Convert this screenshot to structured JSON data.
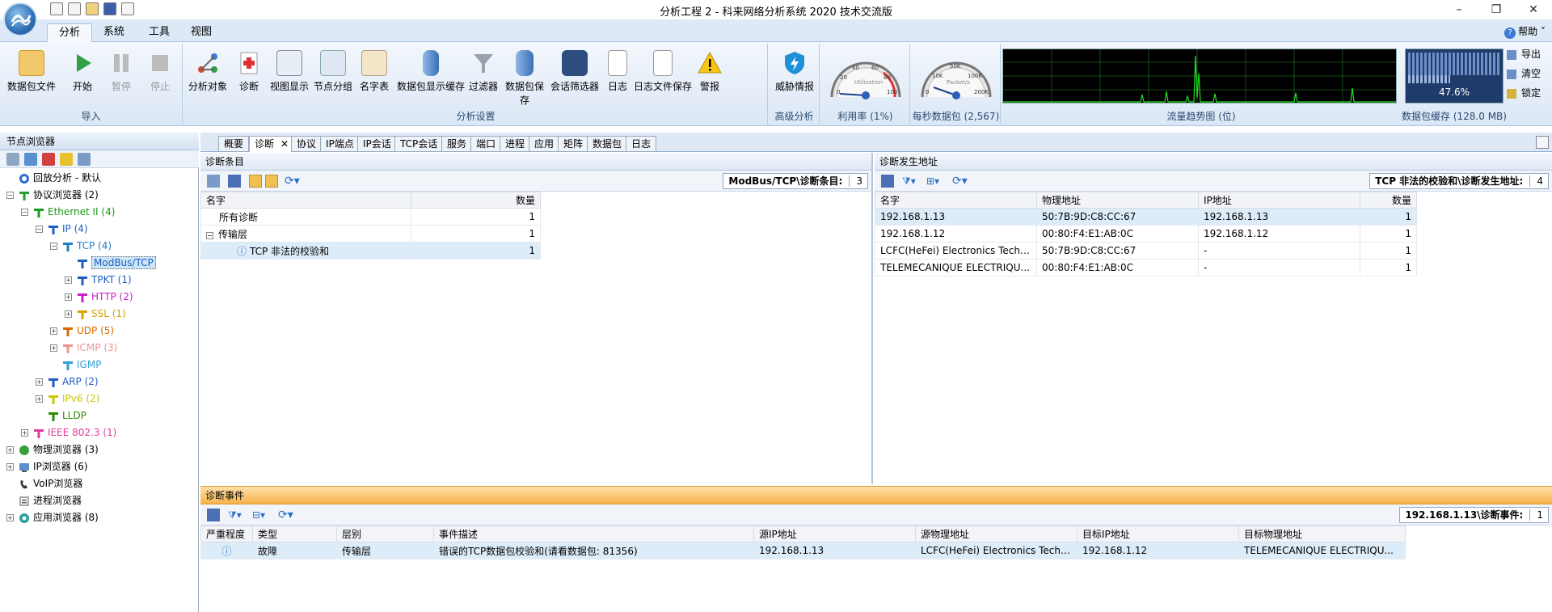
{
  "window": {
    "title": "分析工程 2 - 科来网络分析系统 2020 技术交流版",
    "min": "–",
    "max": "❐",
    "close": "✕"
  },
  "ribbon": {
    "tabs": [
      "分析",
      "系统",
      "工具",
      "视图"
    ],
    "help": "帮助",
    "groups": {
      "import": "导入",
      "analysis_settings": "分析设置",
      "advanced": "高级分析",
      "utilization": "利用率 (1%)",
      "pps": "每秒数据包 (2,567)",
      "trend": "流量趋势图 (位)",
      "buffer": "数据包缓存 (128.0 MB)"
    },
    "buttons": {
      "packet_file": "数据包文件",
      "start": "开始",
      "pause": "暂停",
      "stop": "停止",
      "analysis_object": "分析对象",
      "diagnosis": "诊断",
      "view_display": "视图显示",
      "node_group": "节点分组",
      "name_table": "名字表",
      "packet_display_buffer": "数据包显示缓存",
      "filter": "过滤器",
      "packet_save": "数据包保存",
      "session_filter": "会话筛选器",
      "log": "日志",
      "log_file_save": "日志文件保存",
      "alarm": "警报",
      "threat_intel": "威胁情报"
    },
    "gauge_util_label": "Utilization",
    "gauge_util_ticks": [
      "0",
      "20",
      "40",
      "60",
      "80",
      "100"
    ],
    "gauge_pps_label": "Packet/s",
    "gauge_pps_ticks": [
      "0",
      "10K",
      "50K",
      "100K",
      "200K"
    ],
    "buffer_pct": "47.6%",
    "side_buttons": [
      "导出",
      "清空",
      "锁定"
    ]
  },
  "node_browser": {
    "title": "节点浏览器",
    "tree": [
      {
        "label": "回放分析 - 默认",
        "color": "#000000"
      },
      {
        "label": "协议浏览器 (2)",
        "color": "#000000"
      },
      {
        "label": "Ethernet II (4)",
        "color": "#1a9a1a"
      },
      {
        "label": "IP (4)",
        "color": "#1f5fbf"
      },
      {
        "label": "TCP (4)",
        "color": "#1f7fbf"
      },
      {
        "label": "ModBus/TCP",
        "color": "#1f5fbf"
      },
      {
        "label": "TPKT (1)",
        "color": "#1f5fbf"
      },
      {
        "label": "HTTP (2)",
        "color": "#c81fc8"
      },
      {
        "label": "SSL (1)",
        "color": "#d8a000"
      },
      {
        "label": "UDP (5)",
        "color": "#d86a00"
      },
      {
        "label": "ICMP (3)",
        "color": "#f09090"
      },
      {
        "label": "IGMP",
        "color": "#2fa0d8"
      },
      {
        "label": "ARP (2)",
        "color": "#1f5fbf"
      },
      {
        "label": "IPv6 (2)",
        "color": "#c8c800"
      },
      {
        "label": "LLDP",
        "color": "#2a8a00"
      },
      {
        "label": "IEEE 802.3 (1)",
        "color": "#e03aa0"
      },
      {
        "label": "物理浏览器 (3)",
        "color": "#000000"
      },
      {
        "label": "IP浏览器 (6)",
        "color": "#000000"
      },
      {
        "label": "VoIP浏览器",
        "color": "#000000"
      },
      {
        "label": "进程浏览器",
        "color": "#000000"
      },
      {
        "label": "应用浏览器 (8)",
        "color": "#000000"
      }
    ]
  },
  "center_tabs": [
    "概要",
    "诊断",
    "协议",
    "IP端点",
    "IP会话",
    "TCP会话",
    "服务",
    "端口",
    "进程",
    "应用",
    "矩阵",
    "数据包",
    "日志"
  ],
  "diag_items": {
    "title": "诊断条目",
    "crumb": "ModBus/TCP\\诊断条目:",
    "count": "3",
    "columns": [
      "名字",
      "数量"
    ],
    "rows": [
      {
        "name": "所有诊断",
        "count": "1"
      },
      {
        "name": "传输层",
        "count": "1"
      },
      {
        "name": "TCP 非法的校验和",
        "count": "1"
      }
    ]
  },
  "diag_addresses": {
    "title": "诊断发生地址",
    "crumb": "TCP 非法的校验和\\诊断发生地址:",
    "count": "4",
    "columns": [
      "名字",
      "物理地址",
      "IP地址",
      "数量"
    ],
    "rows": [
      {
        "name": "192.168.1.13",
        "mac": "50:7B:9D:C8:CC:67",
        "ip": "192.168.1.13",
        "count": "1"
      },
      {
        "name": "192.168.1.12",
        "mac": "00:80:F4:E1:AB:0C",
        "ip": "192.168.1.12",
        "count": "1"
      },
      {
        "name": "LCFC(HeFei) Electronics Techn...",
        "mac": "50:7B:9D:C8:CC:67",
        "ip": "-",
        "count": "1"
      },
      {
        "name": "TELEMECANIQUE ELECTRIQU...",
        "mac": "00:80:F4:E1:AB:0C",
        "ip": "-",
        "count": "1"
      }
    ]
  },
  "diag_events": {
    "title": "诊断事件",
    "crumb": "192.168.1.13\\诊断事件:",
    "count": "1",
    "columns": [
      "严重程度",
      "类型",
      "层别",
      "事件描述",
      "源IP地址",
      "源物理地址",
      "目标IP地址",
      "目标物理地址"
    ],
    "rows": [
      {
        "severity": "ⓘ",
        "type": "故障",
        "layer": "传输层",
        "desc": "错误的TCP数据包校验和(请看数据包: 81356)",
        "src_ip": "192.168.1.13",
        "src_mac": "LCFC(HeFei) Electronics Techn...",
        "dst_ip": "192.168.1.12",
        "dst_mac": "TELEMECANIQUE ELECTRIQU..."
      }
    ]
  }
}
